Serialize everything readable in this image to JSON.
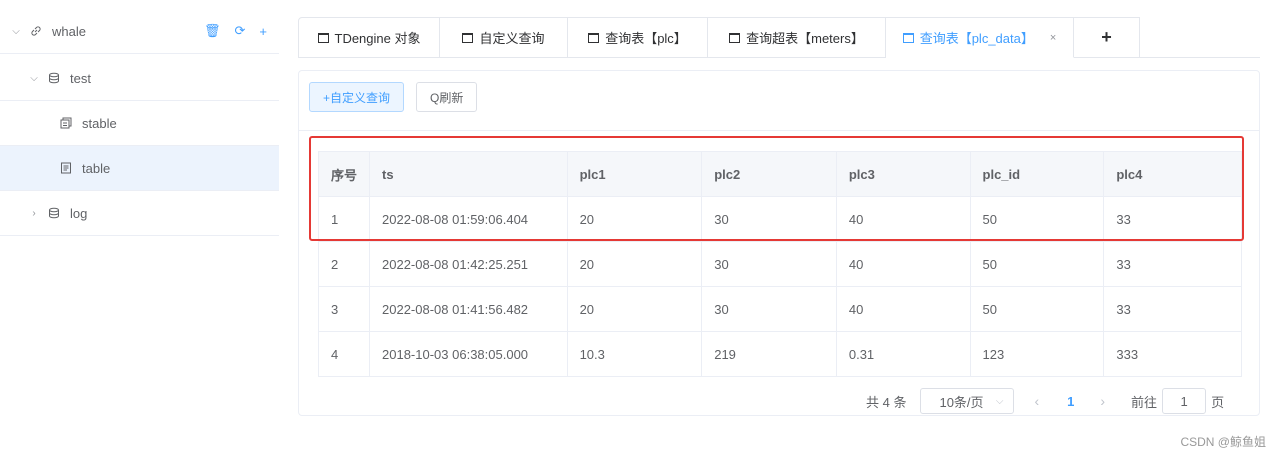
{
  "sidebar": {
    "root": {
      "label": "whale",
      "actions": [
        "🗑",
        "⟳",
        "+"
      ]
    },
    "items": [
      {
        "label": "test",
        "type": "database",
        "expanded": true
      },
      {
        "label": "stable",
        "type": "stable"
      },
      {
        "label": "table",
        "type": "table",
        "selected": true
      },
      {
        "label": "log",
        "type": "database",
        "expanded": false
      }
    ]
  },
  "tabs": [
    {
      "label": "TDengine 对象"
    },
    {
      "label": "自定义查询"
    },
    {
      "label": "查询表【plc】"
    },
    {
      "label": "查询超表【meters】"
    },
    {
      "label": "查询表【plc_data】",
      "active": true,
      "close": "×"
    }
  ],
  "tab_add": "+",
  "toolbar": {
    "custom_query": "+自定义查询",
    "refresh": "Q刷新"
  },
  "table": {
    "headers": [
      "序号",
      "ts",
      "plc1",
      "plc2",
      "plc3",
      "plc_id",
      "plc4"
    ],
    "rows": [
      [
        "1",
        "2022-08-08 01:59:06.404",
        "20",
        "30",
        "40",
        "50",
        "33"
      ],
      [
        "2",
        "2022-08-08 01:42:25.251",
        "20",
        "30",
        "40",
        "50",
        "33"
      ],
      [
        "3",
        "2022-08-08 01:41:56.482",
        "20",
        "30",
        "40",
        "50",
        "33"
      ],
      [
        "4",
        "2018-10-03 06:38:05.000",
        "10.3",
        "219",
        "0.31",
        "123",
        "333"
      ]
    ]
  },
  "pagination": {
    "total": "共 4 条",
    "page_size": "10条/页",
    "current_page": "1",
    "goto_label": "前往",
    "goto_value": "1",
    "page_suffix": "页"
  },
  "watermark": "CSDN @鲸鱼姐",
  "colors": {
    "accent": "#409eff",
    "highlight": "#e53935",
    "selected_row": "#ecf3fd"
  }
}
